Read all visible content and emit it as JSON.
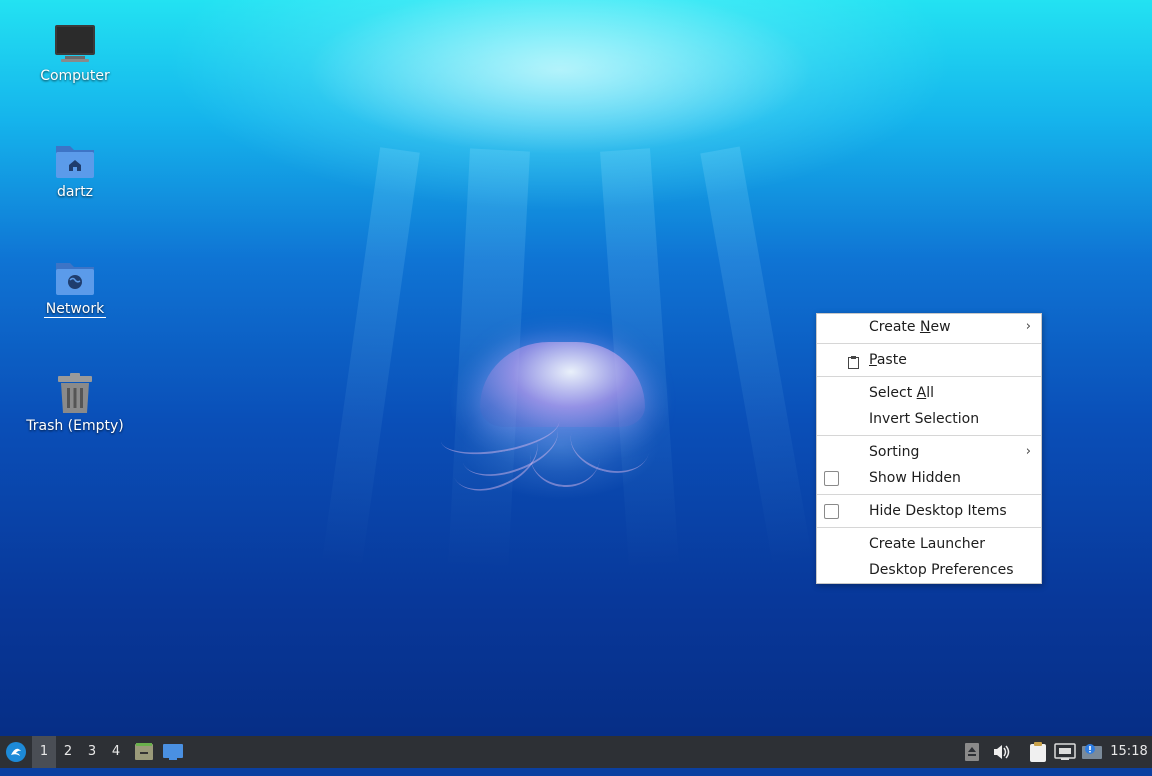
{
  "desktop_icons": [
    {
      "label": "Computer",
      "icon": "computer-icon"
    },
    {
      "label": "dartz",
      "icon": "home-folder-icon"
    },
    {
      "label": "Network",
      "icon": "network-folder-icon"
    },
    {
      "label": "Trash (Empty)",
      "icon": "trash-icon"
    }
  ],
  "context_menu": {
    "create_new": {
      "pre": "Create ",
      "key": "N",
      "post": "ew"
    },
    "paste": {
      "pre": "",
      "key": "P",
      "post": "aste"
    },
    "select_all": {
      "pre": "Select ",
      "key": "A",
      "post": "ll"
    },
    "invert_selection": "Invert Selection",
    "sorting": "Sorting",
    "show_hidden": "Show Hidden",
    "hide_desktop_items": "Hide Desktop Items",
    "create_launcher": "Create Launcher",
    "desktop_preferences": "Desktop Preferences",
    "submenu_arrow": "›"
  },
  "taskbar": {
    "workspaces": [
      "1",
      "2",
      "3",
      "4"
    ],
    "active_workspace": "1",
    "clock": "15:18",
    "tray_icons": [
      "eject-icon",
      "volume-icon",
      "clipboard-icon",
      "network-monitor-icon",
      "update-notifier-icon"
    ]
  },
  "colors": {
    "panel_bg": "#2d3035",
    "menu_bg": "#ffffff",
    "folder_blue": "#4a8fe0"
  }
}
